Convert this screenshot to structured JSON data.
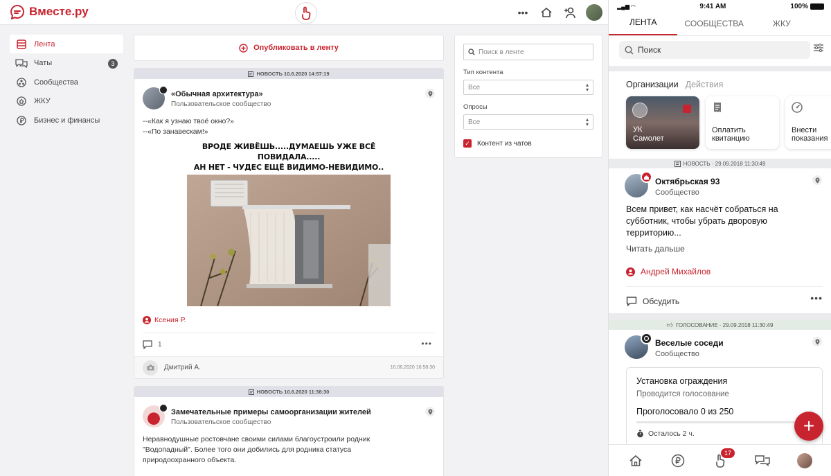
{
  "desktop": {
    "logo": "Вместе.ру",
    "sidebar": {
      "items": [
        {
          "label": "Лента",
          "icon": "feed-icon",
          "active": true
        },
        {
          "label": "Чаты",
          "icon": "chat-icon",
          "badge": "3"
        },
        {
          "label": "Сообщества",
          "icon": "communities-icon"
        },
        {
          "label": "ЖКУ",
          "icon": "zhku-icon"
        },
        {
          "label": "Бизнес и финансы",
          "icon": "business-icon"
        }
      ]
    },
    "publish_label": "Опубликовать в ленту",
    "posts": [
      {
        "header": "НОВОСТЬ 10.6.2020 14:57:19",
        "title": "«Обычная архитектура»",
        "subtitle": "Пользовательское сообщество",
        "text_line1": "--«Как я узнаю твоё окно?»",
        "text_line2": "--«По занавескам!»",
        "meme_line1": "ВРОДЕ ЖИВЁШЬ.....ДУМАЕШЬ УЖЕ ВСЁ ПОВИДАЛА.....",
        "meme_line2": "АН НЕТ - ЧУДЕС ЕЩЁ ВИДИМО-НЕВИДИМО..",
        "author": "Ксения Р.",
        "comments_count": "1",
        "commenter": "Дмитрий А.",
        "comment_time": "10.06.2020 16:58:30"
      },
      {
        "header": "НОВОСТЬ 10.6.2020 11:38:30",
        "title": "Замечательные примеры самоорганизации жителей",
        "subtitle": "Пользовательское сообщество",
        "text_line1": "Неравнодушные ростовчане своими силами благоустроили родник",
        "text_line2": "\"Водопадный\". Более того они добились для родника статуса",
        "text_line3": "природоохранного объекта."
      }
    ],
    "filters": {
      "search_placeholder": "Поиск в ленте",
      "content_type_label": "Тип контента",
      "content_type_value": "Все",
      "polls_label": "Опросы",
      "polls_value": "Все",
      "chat_content_label": "Контент из чатов",
      "chat_content_checked": true
    }
  },
  "mobile": {
    "status": {
      "time": "9:41 AM",
      "battery": "100%"
    },
    "tabs": [
      "ЛЕНТА",
      "СООБЩЕСТВА",
      "ЖКУ"
    ],
    "search_placeholder": "Поиск",
    "org_tabs": [
      "Организации",
      "Действия"
    ],
    "cards": [
      {
        "label_line1": "УК",
        "label_line2": "Самолет"
      },
      {
        "label_line1": "Оплатить",
        "label_line2": "квитанцию",
        "icon": "receipt-icon"
      },
      {
        "label_line1": "Внести",
        "label_line2": "показания",
        "icon": "meter-icon"
      }
    ],
    "posts": [
      {
        "header": "НОВОСТЬ · 29.09.2018 11:30:49",
        "title": "Октябрьская 93",
        "subtitle": "Сообщество",
        "text": "Всем привет, как насчёт собраться на субботник, чтобы убрать дворовую территорию...",
        "more": "Читать дальше",
        "author": "Андрей Михайлов",
        "discuss": "Обсудить"
      },
      {
        "header": "ГОЛОСОВАНИЕ · 29.09.2018 11:30:49",
        "title": "Веселые соседи",
        "subtitle": "Сообщество",
        "poll_title": "Установка ограждения",
        "poll_status": "Проводится голосование",
        "poll_count": "Проголосовало 0 из 250",
        "poll_progress": 0,
        "poll_left": "Осталось 2 ч."
      }
    ],
    "bottom_nav": [
      {
        "icon": "home-icon"
      },
      {
        "icon": "ruble-icon"
      },
      {
        "icon": "hand-icon",
        "badge": "17"
      },
      {
        "icon": "chats-icon"
      },
      {
        "icon": "profile-avatar"
      }
    ]
  },
  "colors": {
    "accent": "#c8242f",
    "bg": "#f2f2f4",
    "header_strip": "#dfe0e8"
  }
}
